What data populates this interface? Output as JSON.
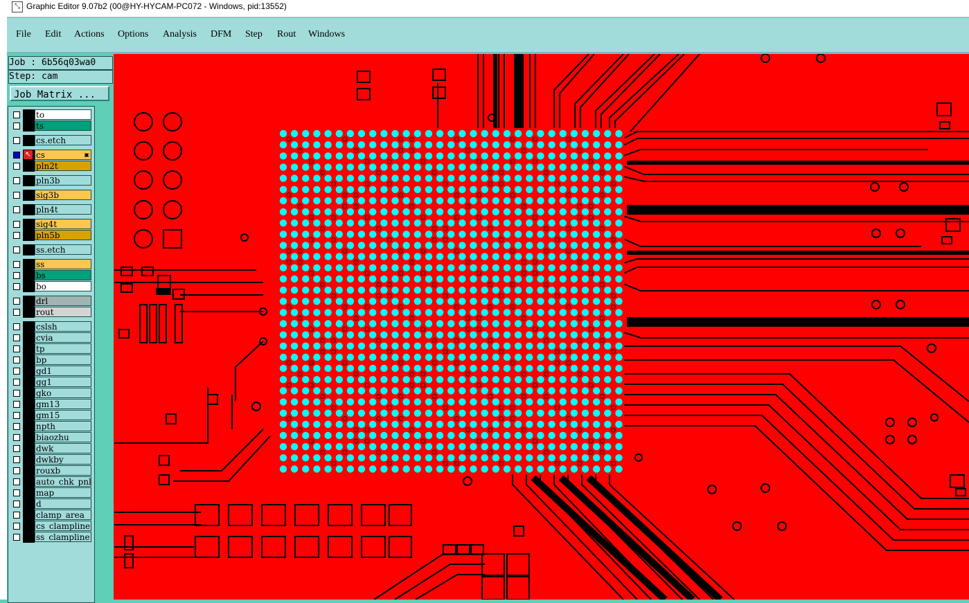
{
  "window": {
    "title": "Graphic Editor 9.07b2 (00@HY-HYCAM-PC072 - Windows, pid:13552)"
  },
  "menu": [
    {
      "label": "File"
    },
    {
      "label": "Edit"
    },
    {
      "label": "Actions"
    },
    {
      "label": "Options"
    },
    {
      "label": "Analysis"
    },
    {
      "label": "DFM"
    },
    {
      "label": "Step"
    },
    {
      "label": "Rout"
    },
    {
      "label": "Windows"
    }
  ],
  "job": {
    "line": "Job : 6b56q03wa0"
  },
  "step": {
    "line": "Step: cam"
  },
  "job_matrix_label": "Job Matrix ...",
  "layers": [
    {
      "name": "to",
      "color": "#ffffff"
    },
    {
      "name": "ts",
      "color": "#00a07a"
    },
    {
      "name": "cs.etch",
      "color": "#a1dcdb"
    },
    {
      "name": "cs",
      "color": "#ffc64d",
      "active": true
    },
    {
      "name": "pln2t",
      "color": "#d9a100"
    },
    {
      "name": "pln3b",
      "color": "#a1dcdb"
    },
    {
      "name": "sig3b",
      "color": "#ffc64d"
    },
    {
      "name": "pln4t",
      "color": "#a1dcdb"
    },
    {
      "name": "sig4t",
      "color": "#ffc64d"
    },
    {
      "name": "pln5b",
      "color": "#d9a100"
    },
    {
      "name": "ss.etch",
      "color": "#a1dcdb"
    },
    {
      "name": "ss",
      "color": "#ffc64d"
    },
    {
      "name": "bs",
      "color": "#00a07a"
    },
    {
      "name": "bo",
      "color": "#ffffff"
    },
    {
      "name": "drl",
      "color": "#a0b4b4"
    },
    {
      "name": "rout",
      "color": "#d4d4d4"
    },
    {
      "name": "cslsh",
      "color": "#a1dcdb"
    },
    {
      "name": "cvia",
      "color": "#a1dcdb"
    },
    {
      "name": "tp",
      "color": "#a1dcdb"
    },
    {
      "name": "bp",
      "color": "#a1dcdb"
    },
    {
      "name": "gd1",
      "color": "#a1dcdb"
    },
    {
      "name": "gg1",
      "color": "#a1dcdb"
    },
    {
      "name": "gko",
      "color": "#a1dcdb"
    },
    {
      "name": "gm13",
      "color": "#a1dcdb"
    },
    {
      "name": "gm15",
      "color": "#a1dcdb"
    },
    {
      "name": "npth",
      "color": "#a1dcdb"
    },
    {
      "name": "biaozhu",
      "color": "#a1dcdb"
    },
    {
      "name": "dwk",
      "color": "#a1dcdb"
    },
    {
      "name": "dwkby",
      "color": "#a1dcdb"
    },
    {
      "name": "rouxb",
      "color": "#a1dcdb"
    },
    {
      "name": "auto_chk_pnl",
      "color": "#a1dcdb"
    },
    {
      "name": "map",
      "color": "#a1dcdb"
    },
    {
      "name": "d",
      "color": "#a1dcdb"
    },
    {
      "name": "clamp_area",
      "color": "#a1dcdb"
    },
    {
      "name": "cs_clampline",
      "color": "#a1dcdb"
    },
    {
      "name": "ss_clampline",
      "color": "#a1dcdb"
    }
  ],
  "colors": {
    "board_background": "#ff0000",
    "copper_trace": "#000000",
    "bga_pad": "#00ffff",
    "panel_background": "#5fcfb7",
    "menu_background": "#a1dcdb"
  },
  "icons": {
    "app": "graphic-editor-icon",
    "active_layer": "pointer-arrow-icon"
  }
}
